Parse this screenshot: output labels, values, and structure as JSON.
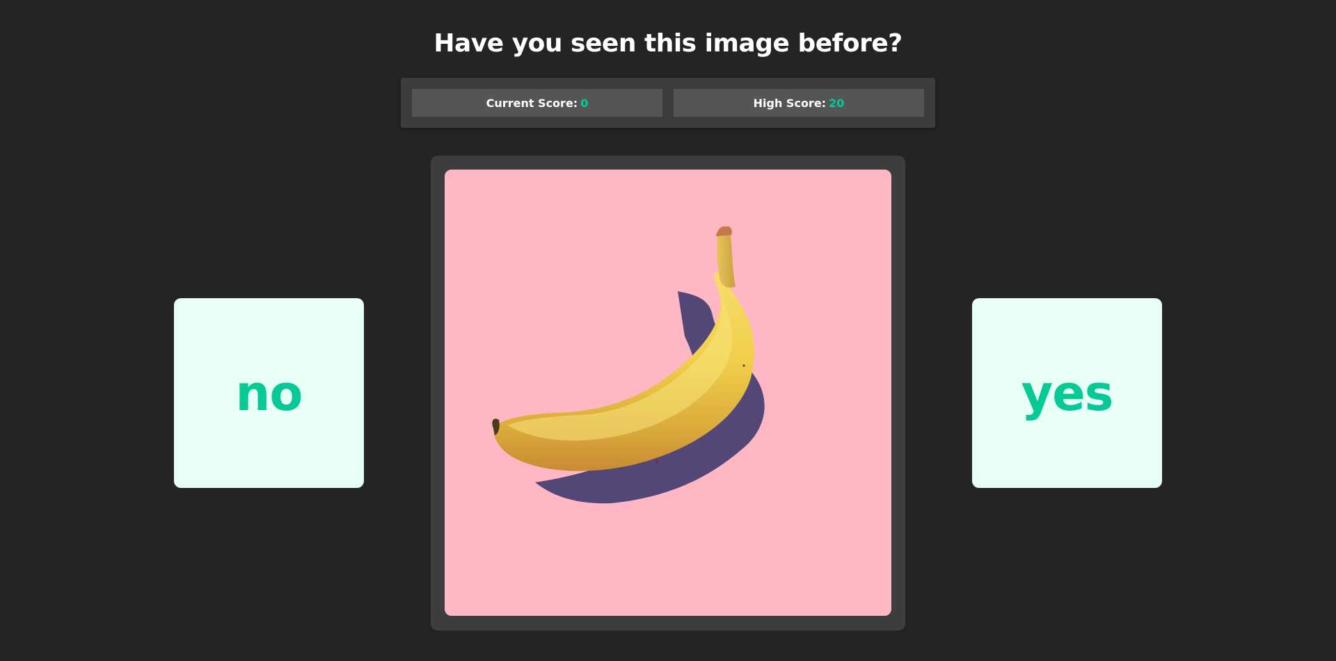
{
  "header": {
    "title": "Have you seen this image before?"
  },
  "scores": {
    "current_label": "Current Score:",
    "current_value": "0",
    "high_label": "High Score:",
    "high_value": "20"
  },
  "image": {
    "subject": "banana-image",
    "background_color": "#ffb7c3"
  },
  "answers": {
    "no_label": "no",
    "yes_label": "yes"
  },
  "colors": {
    "background": "#242424",
    "panel": "#3d3d3d",
    "accent": "#06c995",
    "card": "#e8fff6"
  }
}
